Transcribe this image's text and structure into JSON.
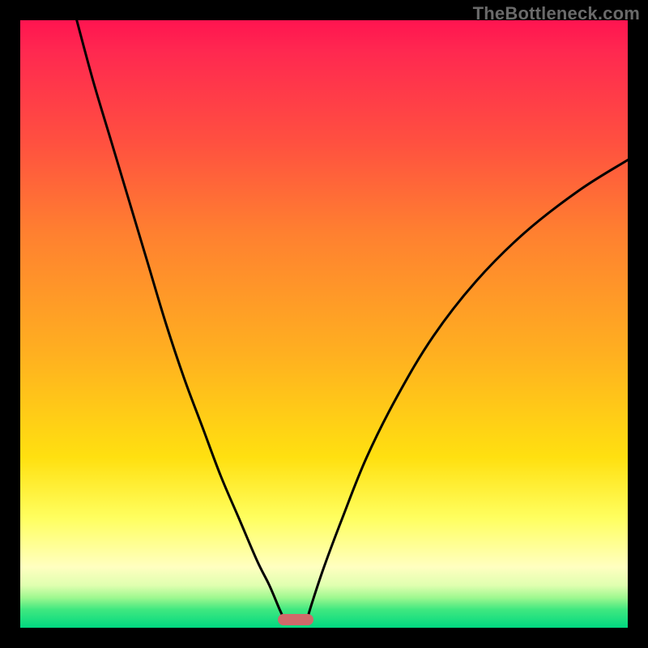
{
  "watermark": "TheBottleneck.com",
  "chart_data": {
    "type": "line",
    "title": "",
    "xlabel": "",
    "ylabel": "",
    "xlim": [
      0,
      100
    ],
    "ylim": [
      0,
      100
    ],
    "grid": false,
    "legend": false,
    "background_gradient": {
      "top": "#ff1450",
      "mid_high": "#ff8030",
      "mid": "#ffe010",
      "mid_low": "#ffffc0",
      "bottom": "#00d880"
    },
    "marker": {
      "x": 45.3,
      "y": 1.3,
      "color": "#cf6a6a",
      "shape": "rounded-rect"
    },
    "series": [
      {
        "name": "left-curve",
        "color": "#000000",
        "x": [
          9.3,
          12,
          15,
          18,
          21,
          24,
          27,
          30,
          33,
          36,
          39,
          41,
          42.7,
          43.5
        ],
        "y": [
          100,
          90,
          80,
          70,
          60,
          50,
          41,
          33,
          25,
          18,
          11,
          7,
          3,
          1.3
        ]
      },
      {
        "name": "right-curve",
        "color": "#000000",
        "x": [
          47.2,
          48,
          50,
          53,
          57,
          62,
          68,
          75,
          83,
          92,
          100
        ],
        "y": [
          1.3,
          4,
          10,
          18,
          28,
          38,
          48,
          57,
          65,
          72,
          77
        ]
      }
    ]
  }
}
